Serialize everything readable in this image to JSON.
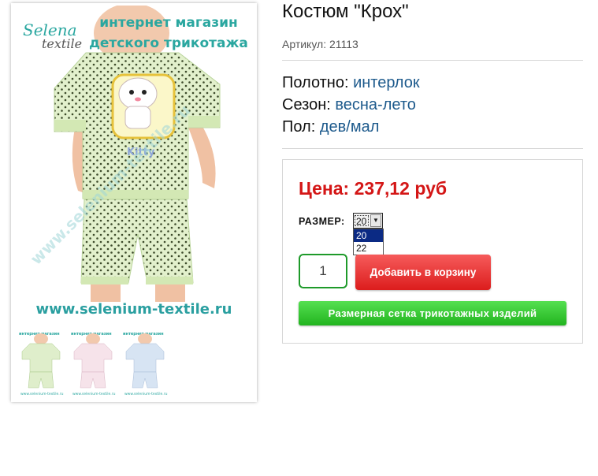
{
  "product": {
    "title": "Костюм \"Крох\"",
    "sku_label": "Артикул:",
    "sku_value": "21113",
    "properties": [
      {
        "key": "Полотно:",
        "value": "интерлок"
      },
      {
        "key": "Сезон:",
        "value": "весна-лето"
      },
      {
        "key": "Пол:",
        "value": "дев/мал"
      }
    ]
  },
  "gallery": {
    "logo_line1": "Selena",
    "logo_line2": "textile",
    "store_title_line1": "интернет магазин",
    "store_title_line2": "детского трикотажа",
    "site_url": "www.selenium-textile.ru",
    "thumbnail_colors": [
      "#dfeecb",
      "#f6e3ea",
      "#d7e4f3"
    ]
  },
  "buy": {
    "price_label": "Цена:",
    "price_value": "237,12 руб",
    "size_label": "РАЗМЕР:",
    "size_selected": "20",
    "size_options": [
      "20",
      "22"
    ],
    "quantity": "1",
    "add_to_cart": "Добавить в корзину",
    "size_chart": "Размерная сетка трикотажных изделий"
  },
  "colors": {
    "price": "#d41616",
    "property_value": "#1d5a8c",
    "add_button": "#dc1d1d",
    "size_chart_button": "#22b41f"
  }
}
